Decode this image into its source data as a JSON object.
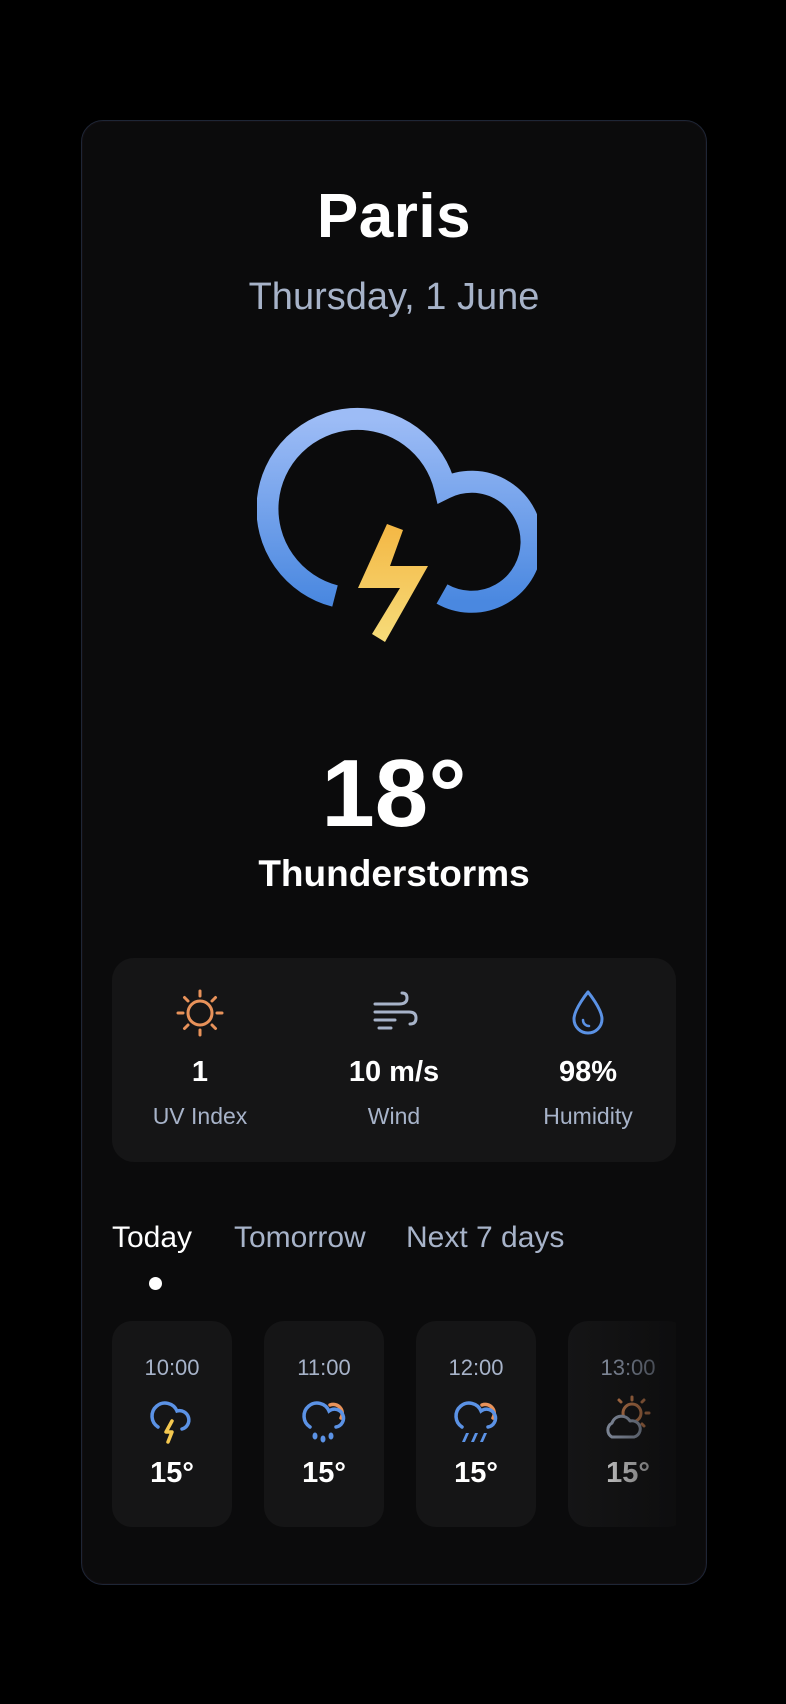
{
  "location": {
    "city": "Paris",
    "date": "Thursday, 1 June"
  },
  "current": {
    "temperature": "18°",
    "condition": "Thunderstorms",
    "icon": "thunderstorm-icon"
  },
  "stats": [
    {
      "icon": "sun-icon",
      "value": "1",
      "label": "UV Index"
    },
    {
      "icon": "wind-icon",
      "value": "10 m/s",
      "label": "Wind"
    },
    {
      "icon": "droplet-icon",
      "value": "98%",
      "label": "Humidity"
    }
  ],
  "tabs": [
    {
      "label": "Today",
      "active": true
    },
    {
      "label": "Tomorrow",
      "active": false
    },
    {
      "label": "Next 7 days",
      "active": false
    }
  ],
  "hourly": [
    {
      "time": "10:00",
      "temp": "15°",
      "icon": "thunderstorm-small-icon"
    },
    {
      "time": "11:00",
      "temp": "15°",
      "icon": "rain-sun-icon"
    },
    {
      "time": "12:00",
      "temp": "15°",
      "icon": "heavy-rain-sun-icon"
    },
    {
      "time": "13:00",
      "temp": "15°",
      "icon": "partly-cloudy-icon"
    }
  ],
  "colors": {
    "background": "#000000",
    "card": "#0b0b0c",
    "panel": "#151516",
    "text_primary": "#ffffff",
    "text_secondary": "#a7b3c9",
    "accent_blue": "#5b92e5",
    "accent_yellow": "#f4c84f",
    "accent_orange": "#e8925a"
  }
}
